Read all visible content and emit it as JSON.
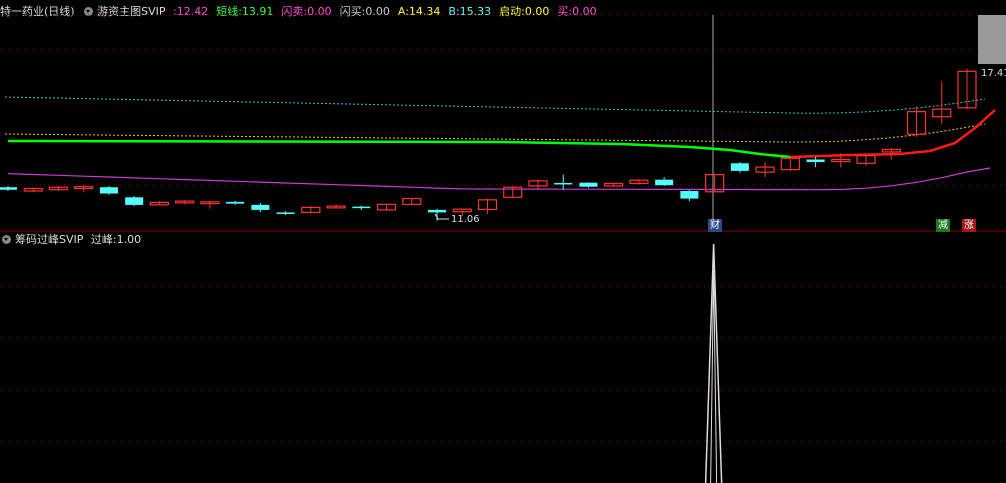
{
  "main_legend": {
    "stock": "特一药业",
    "period": "(日线)",
    "indicator": "游资主图SVIP",
    "items": [
      {
        "label": ":",
        "value": "12.42",
        "color": "#ff4fd8"
      },
      {
        "label": "短线:",
        "value": "13.91",
        "color": "#3cff3c"
      },
      {
        "label": "闪卖:",
        "value": "0.00",
        "color": "#ff4fd8"
      },
      {
        "label": "闪买:",
        "value": "0.00",
        "color": "#cccccc"
      },
      {
        "label": "A:",
        "value": "14.34",
        "color": "#ffff3c"
      },
      {
        "label": "B:",
        "value": "15.33",
        "color": "#5ff8ff"
      },
      {
        "label": "启动:",
        "value": "0.00",
        "color": "#ffff3c"
      },
      {
        "label": "买:",
        "value": "0.00",
        "color": "#ff4fd8"
      }
    ]
  },
  "sub_legend": {
    "indicator": "筹码过峰SVIP",
    "label": "过峰:",
    "value": "1.00"
  },
  "labels": {
    "low_price": "11.06",
    "high_price": "17.41",
    "marker_cai": "财",
    "marker_jian": "减",
    "marker_zhang": "涨"
  },
  "colors": {
    "up": "#ff3232",
    "down": "#54ffff",
    "green_line": "#00ff00",
    "red_line": "#ff1a1a",
    "magenta_line": "#c83cd2",
    "cyan_dotted": "#3cc8c8",
    "yellow_dotted": "#e6c83c",
    "grid": "#7a0000"
  },
  "chart_data": {
    "type": "candlestick",
    "candles": [
      {
        "o": 12.4,
        "c": 12.3,
        "h": 12.45,
        "l": 12.25
      },
      {
        "o": 12.25,
        "c": 12.35,
        "h": 12.4,
        "l": 12.2
      },
      {
        "o": 12.3,
        "c": 12.4,
        "h": 12.45,
        "l": 12.25
      },
      {
        "o": 12.35,
        "c": 12.42,
        "h": 12.5,
        "l": 12.2
      },
      {
        "o": 12.4,
        "c": 12.15,
        "h": 12.45,
        "l": 12.1
      },
      {
        "o": 12.0,
        "c": 11.7,
        "h": 12.05,
        "l": 11.65
      },
      {
        "o": 11.7,
        "c": 11.8,
        "h": 11.85,
        "l": 11.68
      },
      {
        "o": 11.78,
        "c": 11.85,
        "h": 11.88,
        "l": 11.72
      },
      {
        "o": 11.75,
        "c": 11.82,
        "h": 11.85,
        "l": 11.55
      },
      {
        "o": 11.82,
        "c": 11.75,
        "h": 11.86,
        "l": 11.7
      },
      {
        "o": 11.7,
        "c": 11.5,
        "h": 11.78,
        "l": 11.42
      },
      {
        "o": 11.4,
        "c": 11.35,
        "h": 11.45,
        "l": 11.3
      },
      {
        "o": 11.4,
        "c": 11.6,
        "h": 11.65,
        "l": 11.36
      },
      {
        "o": 11.58,
        "c": 11.65,
        "h": 11.72,
        "l": 11.56
      },
      {
        "o": 11.63,
        "c": 11.61,
        "h": 11.67,
        "l": 11.5
      },
      {
        "o": 11.5,
        "c": 11.72,
        "h": 11.75,
        "l": 11.48
      },
      {
        "o": 11.72,
        "c": 11.95,
        "h": 11.97,
        "l": 11.7
      },
      {
        "o": 11.5,
        "c": 11.4,
        "h": 11.55,
        "l": 11.06
      },
      {
        "o": 11.43,
        "c": 11.53,
        "h": 11.56,
        "l": 11.25
      },
      {
        "o": 11.52,
        "c": 11.9,
        "h": 11.95,
        "l": 11.35
      },
      {
        "o": 12.0,
        "c": 12.4,
        "h": 12.45,
        "l": 11.98
      },
      {
        "o": 12.45,
        "c": 12.65,
        "h": 12.7,
        "l": 12.35
      },
      {
        "o": 12.57,
        "c": 12.55,
        "h": 12.9,
        "l": 12.3
      },
      {
        "o": 12.58,
        "c": 12.42,
        "h": 12.6,
        "l": 12.38
      },
      {
        "o": 12.45,
        "c": 12.55,
        "h": 12.6,
        "l": 12.43
      },
      {
        "o": 12.55,
        "c": 12.68,
        "h": 12.72,
        "l": 12.5
      },
      {
        "o": 12.7,
        "c": 12.48,
        "h": 12.8,
        "l": 12.45
      },
      {
        "o": 12.25,
        "c": 11.95,
        "h": 12.3,
        "l": 11.85
      },
      {
        "o": 12.22,
        "c": 12.9,
        "h": 12.95,
        "l": 12.2
      },
      {
        "o": 13.35,
        "c": 13.05,
        "h": 13.4,
        "l": 12.98
      },
      {
        "o": 13.0,
        "c": 13.2,
        "h": 13.4,
        "l": 12.8
      },
      {
        "o": 13.1,
        "c": 13.55,
        "h": 13.62,
        "l": 13.05
      },
      {
        "o": 13.5,
        "c": 13.4,
        "h": 13.6,
        "l": 13.2
      },
      {
        "o": 13.42,
        "c": 13.5,
        "h": 13.75,
        "l": 13.18
      },
      {
        "o": 13.35,
        "c": 13.65,
        "h": 13.7,
        "l": 13.25
      },
      {
        "o": 13.8,
        "c": 13.9,
        "h": 13.95,
        "l": 13.5
      },
      {
        "o": 14.5,
        "c": 15.4,
        "h": 15.6,
        "l": 14.4
      },
      {
        "o": 15.2,
        "c": 15.5,
        "h": 16.6,
        "l": 14.9
      },
      {
        "o": 15.55,
        "c": 17.0,
        "h": 17.1,
        "l": 15.5
      }
    ],
    "upper_price": 17.41,
    "low_price": 11.06,
    "sub_series": {
      "name": "过峰",
      "peak_index": 28,
      "value": 1.0
    }
  }
}
